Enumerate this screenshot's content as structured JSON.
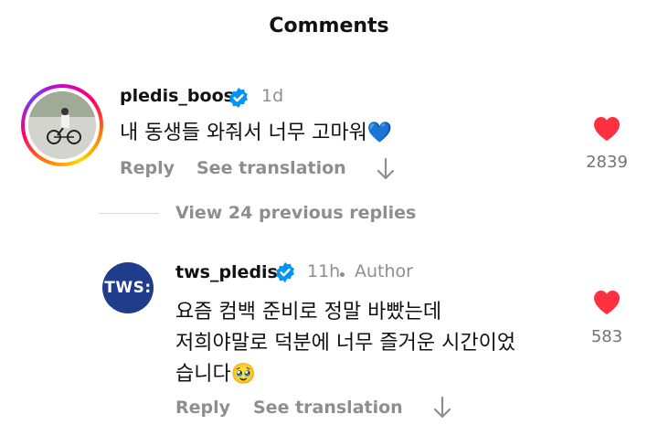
{
  "header": {
    "title": "Comments"
  },
  "comments": [
    {
      "username": "pledis_boos",
      "verified": true,
      "time": "1d",
      "text_lines": [
        "내 동생들 와줘서 너무 고마워💙"
      ],
      "reply_label": "Reply",
      "translate_label": "See translation",
      "likes": "2839"
    }
  ],
  "thread": {
    "view_more_label": "View 24 previous replies"
  },
  "replies": [
    {
      "username": "tws_pledis",
      "avatar_text": "TWS:",
      "verified": true,
      "time": "11h",
      "author_badge": "Author",
      "text_lines": [
        "요즘 컴백 준비로 정말 바빴는데",
        "저희야말로 덕분에 너무 즐거운 시간이었",
        "습니다🥹"
      ],
      "reply_label": "Reply",
      "translate_label": "See translation",
      "likes": "583"
    }
  ],
  "colors": {
    "verified": "#0095f6",
    "heart": "#ff3040",
    "tws_avatar": "#1f3d8a"
  }
}
